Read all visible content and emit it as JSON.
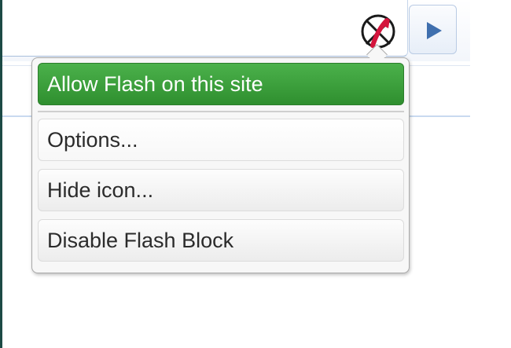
{
  "browser": {
    "flash_icon": "flash-blocked-icon",
    "go_icon": "play-arrow-icon"
  },
  "menu": {
    "items": [
      {
        "label": "Allow Flash on this site"
      },
      {
        "label": "Options..."
      },
      {
        "label": "Hide icon..."
      },
      {
        "label": "Disable Flash Block"
      }
    ]
  },
  "colors": {
    "primary_button": "#3a9f3a",
    "go_arrow": "#3f6fae",
    "icon_cross": "#d4143c",
    "window_edge": "#1c4a45"
  }
}
